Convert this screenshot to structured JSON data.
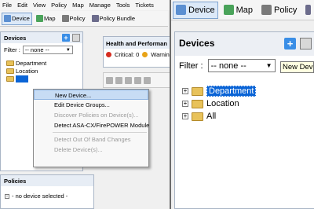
{
  "menubar": [
    "File",
    "Edit",
    "View",
    "Policy",
    "Map",
    "Manage",
    "Tools",
    "Tickets"
  ],
  "toolbar": [
    {
      "label": "Device",
      "icon": "device-icon",
      "selected": true
    },
    {
      "label": "Map",
      "icon": "map-icon",
      "selected": false
    },
    {
      "label": "Policy",
      "icon": "policy-icon",
      "selected": false
    },
    {
      "label": "Policy Bundle",
      "icon": "policy-bundle-icon",
      "selected": false
    }
  ],
  "devices_panel": {
    "title": "Devices",
    "filter_label": "Filter :",
    "filter_value": "-- none --",
    "tree": [
      "Department",
      "Location"
    ]
  },
  "health_panel": {
    "title": "Health and Performan",
    "critical": "Critical: 0",
    "warning": "Warnin"
  },
  "context_menu": {
    "items": [
      {
        "label": "New Device...",
        "state": "highlighted"
      },
      {
        "label": "Edit Device Groups...",
        "state": "enabled"
      },
      {
        "label": "Discover Policies on Device(s)...",
        "state": "disabled"
      },
      {
        "label": "Detect ASA-CX/FirePOWER Module",
        "state": "enabled"
      },
      {
        "label": "Detect Out Of Band Changes",
        "state": "disabled"
      },
      {
        "label": "Delete Device(s)...",
        "state": "disabled"
      }
    ]
  },
  "policies_panel": {
    "title": "Policies",
    "status": "- no device selected -"
  },
  "zoom": {
    "toolbar": [
      "Device",
      "Map",
      "Policy",
      "Policy Bundle"
    ],
    "title": "Devices",
    "filter_label": "Filter :",
    "filter_value": "-- none --",
    "tree": [
      "Department",
      "Location",
      "All"
    ],
    "tooltip": "New Device"
  },
  "colors": {
    "selection": "#0a64d6",
    "accent_blue": "#3a8ee6",
    "folder": "#e8c25a",
    "panel_border": "#a9b5c6"
  }
}
